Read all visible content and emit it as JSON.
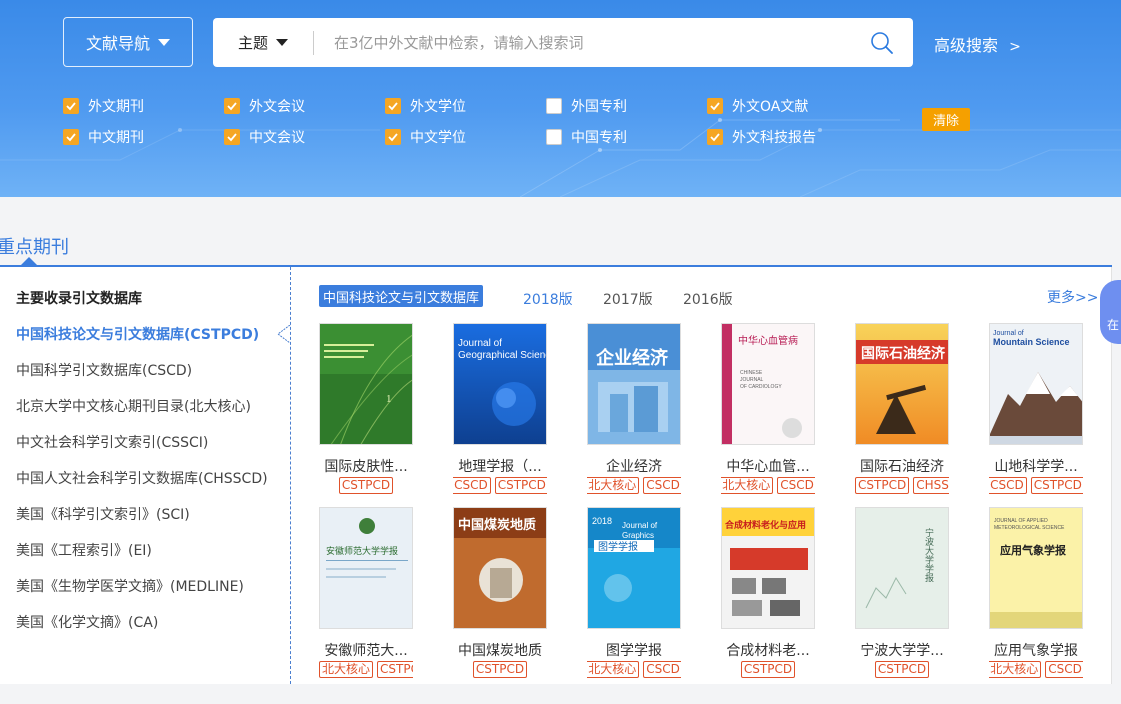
{
  "hero": {
    "nav_label": "文献导航",
    "field_label": "主题",
    "search_placeholder": "在3亿中外文献中检索，请输入搜索词",
    "advanced_label": "高级搜索",
    "advanced_arrow": ">",
    "clear_label": "清除",
    "filters": [
      {
        "label": "外文期刊",
        "checked": true
      },
      {
        "label": "外文会议",
        "checked": true
      },
      {
        "label": "外文学位",
        "checked": true
      },
      {
        "label": "外国专利",
        "checked": false
      },
      {
        "label": "外文OA文献",
        "checked": true
      },
      {
        "label": "中文期刊",
        "checked": true
      },
      {
        "label": "中文会议",
        "checked": true
      },
      {
        "label": "中文学位",
        "checked": true
      },
      {
        "label": "中国专利",
        "checked": false
      },
      {
        "label": "外文科技报告",
        "checked": true
      }
    ]
  },
  "section": {
    "title": "重点期刊",
    "sidebar_heading": "主要收录引文数据库",
    "databases": [
      "中国科技论文与引文数据库(CSTPCD)",
      "中国科学引文数据库(CSCD)",
      "北京大学中文核心期刊目录(北大核心)",
      "中文社会科学引文索引(CSSCI)",
      "中国人文社会科学引文数据库(CHSSCD)",
      "美国《科学引文索引》(SCI)",
      "美国《工程索引》(EI)",
      "美国《生物学医学文摘》(MEDLINE)",
      "美国《化学文摘》(CA)"
    ],
    "active_db": "中国科技论文与引文数据库",
    "years": [
      "2018版",
      "2017版",
      "2016版"
    ],
    "more_label": "更多>>",
    "float_label": "在"
  },
  "journals": [
    {
      "name": "国际皮肤性...",
      "tags": [
        "CSTPCD"
      ],
      "cover_title": "INTERNATIONAL JOURNAL OF DERMATOLOGY AND VENEREOLOGY"
    },
    {
      "name": "地理学报（...",
      "tags": [
        "CSCD",
        "CSTPCD"
      ],
      "cover_title": "Journal of Geographical Sciences"
    },
    {
      "name": "企业经济",
      "tags": [
        "北大核心",
        "CSCD"
      ],
      "cover_title": "企业经济"
    },
    {
      "name": "中华心血管...",
      "tags": [
        "北大核心",
        "CSCD"
      ],
      "cover_title": "CHINESE JOURNAL OF CARDIOLOGY"
    },
    {
      "name": "国际石油经济",
      "tags": [
        "CSTPCD",
        "CHSSCD"
      ],
      "cover_title": "国际石油经济"
    },
    {
      "name": "山地科学学...",
      "tags": [
        "CSCD",
        "CSTPCD"
      ],
      "cover_title": "Journal of Mountain Science"
    },
    {
      "name": "安徽师范大...",
      "tags": [
        "北大核心",
        "CSTPCD"
      ],
      "cover_title": "安徽师范大学学报"
    },
    {
      "name": "中国煤炭地质",
      "tags": [
        "CSTPCD"
      ],
      "cover_title": "中国煤炭地质"
    },
    {
      "name": "图学学报",
      "tags": [
        "北大核心",
        "CSCD"
      ],
      "cover_title": "图学学报"
    },
    {
      "name": "合成材料老...",
      "tags": [
        "CSTPCD"
      ],
      "cover_title": "合成材料老化与应用"
    },
    {
      "name": "宁波大学学...",
      "tags": [
        "CSTPCD"
      ],
      "cover_title": "宁波大学学报"
    },
    {
      "name": "应用气象学报",
      "tags": [
        "北大核心",
        "CSCD"
      ],
      "cover_title": "应用气象学报"
    }
  ],
  "colors": {
    "accent": "#3b7ddd",
    "checkbox": "#f5a623",
    "tag": "#e0522b",
    "clear": "#f5a000"
  }
}
